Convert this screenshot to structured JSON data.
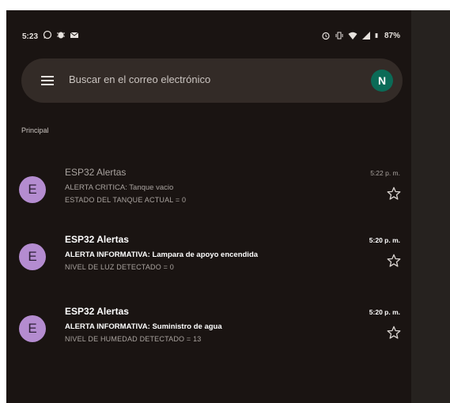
{
  "status_bar": {
    "time": "5:23",
    "battery": "87%",
    "icons_left": [
      "whatsapp-icon",
      "bug-icon",
      "mail-icon"
    ],
    "icons_right": [
      "alarm-icon",
      "vibrate-icon",
      "wifi-icon",
      "signal-icon",
      "battery-icon"
    ]
  },
  "search": {
    "placeholder": "Buscar en el correo electrónico",
    "account_initial": "N"
  },
  "section": {
    "label": "Principal"
  },
  "emails": [
    {
      "avatar": "E",
      "sender": "ESP32 Alertas",
      "subject": "ALERTA CRITICA: Tanque vacio",
      "snippet": "ESTADO DEL TANQUE ACTUAL = 0",
      "time": "5:22 p. m.",
      "read": true
    },
    {
      "avatar": "E",
      "sender": "ESP32 Alertas",
      "subject": "ALERTA INFORMATIVA: Lampara de apoyo encendida",
      "snippet": "NIVEL DE LUZ DETECTADO = 0",
      "time": "5:20 p. m.",
      "read": false
    },
    {
      "avatar": "E",
      "sender": "ESP32 Alertas",
      "subject": "ALERTA INFORMATIVA: Suministro de agua",
      "snippet": "NIVEL DE HUMEDAD DETECTADO = 13",
      "time": "5:20 p. m.",
      "read": false
    }
  ],
  "colors": {
    "background": "#1a1412",
    "search_bar": "#332b27",
    "avatar_purple": "#b48cd0",
    "account_avatar": "#0b6b57"
  }
}
